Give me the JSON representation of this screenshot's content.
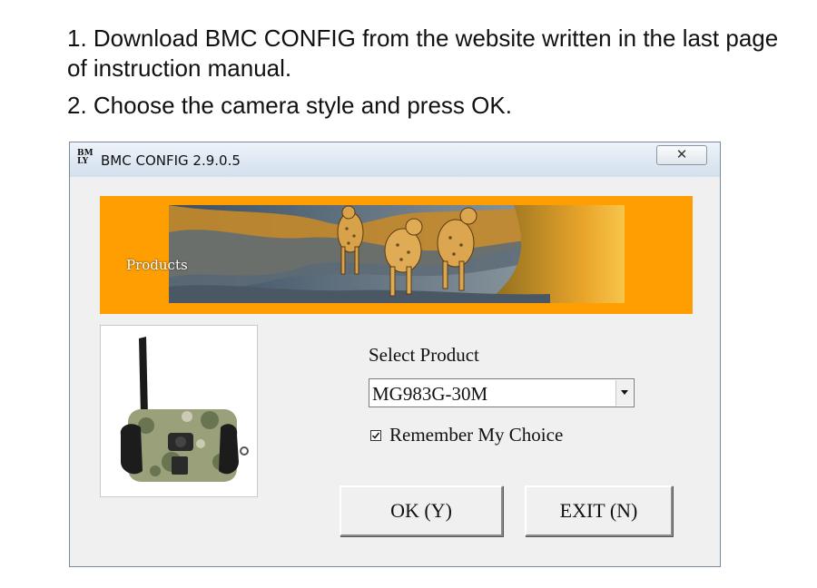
{
  "instructions": {
    "step1": "1. Download BMC CONFIG from the website written in the last page of instruction manual.",
    "step2": "2. Choose the camera style and press OK."
  },
  "window": {
    "title": "BMC CONFIG 2.9.0.5",
    "icon_letters": [
      "BM",
      "LY"
    ],
    "close_symbol": "✕"
  },
  "banner": {
    "label": "Products",
    "background_color": "#ff9e00"
  },
  "form": {
    "select_label": "Select Product",
    "selected_product": "MG983G-30M",
    "remember_label": "Remember My Choice",
    "remember_checked": true
  },
  "buttons": {
    "ok_label": "OK (Y)",
    "exit_label": "EXIT (N)"
  }
}
